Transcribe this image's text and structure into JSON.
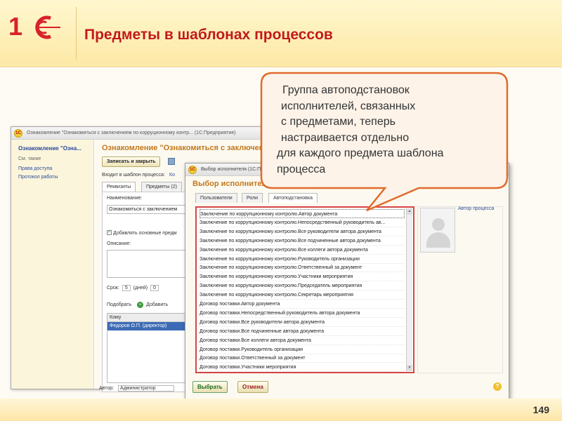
{
  "slide": {
    "title": "Предметы в шаблонах процессов",
    "page_number": "149",
    "logo_text": "1С",
    "callout_lines": [
      "Группа автоподстановок",
      "исполнителей, связанных",
      "с предметами, теперь",
      "настраивается отдельно",
      "для каждого предмета шаблона",
      "процесса"
    ],
    "colors": {
      "title": "#c21a1a",
      "callout_border": "#e06b2c",
      "callout_fill": "#fdf3e9",
      "list_frame": "#d64545",
      "accent_orange": "#c2781e"
    }
  },
  "bg_window": {
    "title": "Ознакомление \"Ознакомиться с заключением по корруционному контр... (1С:Предприятие)",
    "sidebar": {
      "title": "Ознакомление \"Озна...",
      "see_also": "См. также",
      "links": [
        "Права доступа",
        "Протокол работы"
      ]
    },
    "main_title": "Ознакомление \"Ознакомиться с заключением по...",
    "save_close_button": "Записать и закрыть",
    "template_label": "Входит в шаблон процесса:",
    "template_link": "Ко",
    "tabs": [
      "Реквизиты",
      "Предметы (2)"
    ],
    "name_label": "Наименование:",
    "name_value": "Ознакомиться с заключением",
    "add_subjects_checkbox": "Добавлять основные предм",
    "description_label": "Описание:",
    "term_label": "Срок:",
    "term_value": "5",
    "term_unit": "(дней)",
    "term_value2": "0",
    "pick_button": "Подобрать",
    "add_button": "Добавить",
    "grid_header": "Кому",
    "grid_row": "Федоров О.П. (директор)",
    "author_label": "Автор:",
    "author_value": "Администратор"
  },
  "dialog": {
    "window_title": "Выбор исполнителя (1С:Предприятие)",
    "heading": "Выбор исполнителя",
    "tabs": [
      "Пользователи",
      "Роли",
      "Автоподстановка"
    ],
    "active_tab": "Автоподстановка",
    "items": [
      "Заключение по коррупционному контролю.Автор документа",
      "Заключение по коррупционному контролю.Непосредственный руководитель ав...",
      "Заключение по коррупционному контролю.Все руководители автора документа",
      "Заключение по коррупционному контролю.Все подчиненные автора документа",
      "Заключение по коррупционному контролю.Все коллеги автора документа",
      "Заключение по коррупционному контролю.Руководитель организации",
      "Заключение по коррупционному контролю.Ответственный за документ",
      "Заключение по коррупционному контролю.Участники мероприятия",
      "Заключение по коррупционному контролю.Председатель мероприятия",
      "Заключение по коррупционному контролю.Секретарь мероприятия",
      "Договор поставки.Автор документа",
      "Договор поставки.Непосредственный руководитель автора документа",
      "Договор поставки.Все руководители автора документа",
      "Договор поставки.Все подчиненные автора документа",
      "Договор поставки.Все коллеги автора документа",
      "Договор поставки.Руководитель организации",
      "Договор поставки.Ответственный за документ",
      "Договор поставки.Участники мероприятия"
    ],
    "selected_index": 0,
    "author_link": "Автор процесса",
    "ok_button": "Выбрать",
    "cancel_button": "Отмена"
  }
}
